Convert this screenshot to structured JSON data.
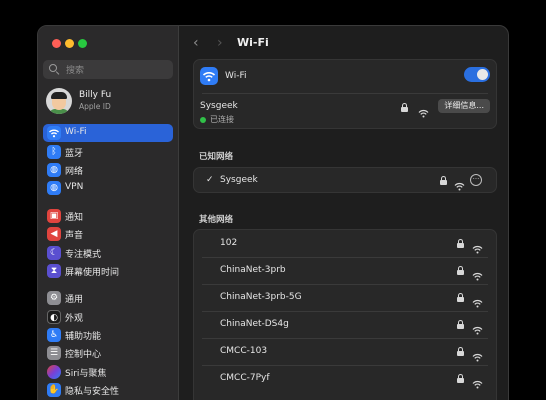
{
  "window": {
    "traffic_lights": [
      "#ff5f57",
      "#febc2e",
      "#28c840"
    ]
  },
  "sidebar": {
    "search_placeholder": "搜索",
    "user": {
      "name": "Billy Fu",
      "subtitle": "Apple ID"
    },
    "items": [
      {
        "label": "Wi-Fi",
        "icon": "wifi-icon",
        "color": "#2f7cf6",
        "active": true
      },
      {
        "label": "蓝牙",
        "icon": "bluetooth-icon",
        "color": "#2f7cf6"
      },
      {
        "label": "网络",
        "icon": "globe-icon",
        "color": "#2f7cf6"
      },
      {
        "label": "VPN",
        "icon": "vpn-globe-icon",
        "color": "#2f7cf6"
      },
      {
        "label": "通知",
        "icon": "bell-icon",
        "color": "#e0443e"
      },
      {
        "label": "声音",
        "icon": "speaker-icon",
        "color": "#e0443e"
      },
      {
        "label": "专注模式",
        "icon": "moon-icon",
        "color": "#5a4fd0"
      },
      {
        "label": "屏幕使用时间",
        "icon": "hourglass-icon",
        "color": "#5a4fd0"
      },
      {
        "label": "通用",
        "icon": "gear-icon",
        "color": "#8e8e93"
      },
      {
        "label": "外观",
        "icon": "appearance-icon",
        "color": "#1c1c1c"
      },
      {
        "label": "辅助功能",
        "icon": "accessibility-icon",
        "color": "#2f7cf6"
      },
      {
        "label": "控制中心",
        "icon": "control-center-icon",
        "color": "#8e8e93"
      },
      {
        "label": "Siri与聚焦",
        "icon": "siri-icon",
        "color": "#7a3fd6"
      },
      {
        "label": "隐私与安全性",
        "icon": "hand-icon",
        "color": "#2f7cf6"
      }
    ]
  },
  "toolbar": {
    "back": "‹",
    "forward": "›",
    "title": "Wi-Fi"
  },
  "wifi_panel": {
    "label": "Wi-Fi",
    "toggle_on": true,
    "current_network": {
      "name": "Sysgeek",
      "status": "已连接",
      "details_button": "详细信息..."
    }
  },
  "known_networks": {
    "title": "已知网络",
    "items": [
      {
        "check": "✓",
        "name": "Sysgeek",
        "more": "···"
      }
    ]
  },
  "other_networks": {
    "title": "其他网络",
    "items": [
      "102",
      "ChinaNet-3prb",
      "ChinaNet-3prb-5G",
      "ChinaNet-DS4g",
      "CMCC-103",
      "CMCC-7Pyf"
    ]
  }
}
